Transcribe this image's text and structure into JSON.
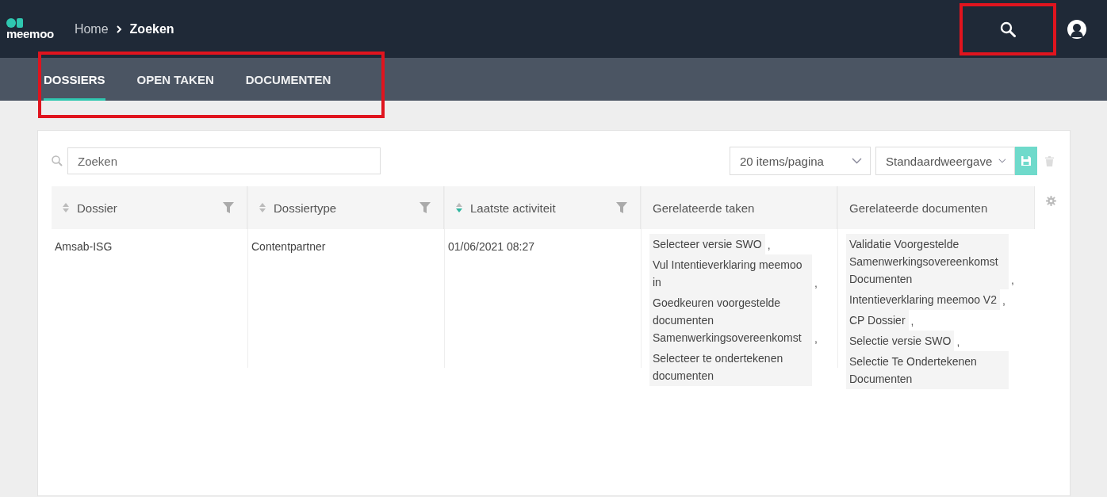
{
  "header": {
    "logo": "meemoo",
    "breadcrumb": [
      {
        "label": "Home",
        "current": false
      },
      {
        "label": "Zoeken",
        "current": true
      }
    ],
    "search_highlighted": true
  },
  "tabs": {
    "highlighted": true,
    "items": [
      {
        "label": "DOSSIERS",
        "selected": true
      },
      {
        "label": "OPEN TAKEN",
        "selected": false
      },
      {
        "label": "DOCUMENTEN",
        "selected": false
      }
    ]
  },
  "toolbar": {
    "search": {
      "placeholder": "Zoeken"
    },
    "page_size": "20 items/pagina",
    "view": "Standaardweergave"
  },
  "table": {
    "columns": [
      {
        "label": "Dossier",
        "sortable": true,
        "sort_descending": false,
        "filterable": true
      },
      {
        "label": "Dossiertype",
        "sortable": true,
        "sort_descending": false,
        "filterable": true
      },
      {
        "label": "Laatste activiteit",
        "sortable": true,
        "sort_descending": true,
        "filterable": true
      },
      {
        "label": "Gerelateerde taken",
        "sortable": false,
        "filterable": false
      },
      {
        "label": "Gerelateerde documenten",
        "sortable": false,
        "filterable": false
      }
    ],
    "rows": [
      {
        "cells": [
          {
            "kind": "text",
            "text": "Amsab-ISG"
          },
          {
            "kind": "text",
            "text": "Contentpartner"
          },
          {
            "kind": "text",
            "text": "01/06/2021 08:27"
          },
          {
            "kind": "links",
            "items": [
              {
                "label": "Selecteer versie SWO",
                "separator": ","
              },
              {
                "label": "Vul Intentieverklaring meemoo in",
                "separator": ","
              },
              {
                "label": "Goedkeuren voorgestelde documenten Samenwerkingsovereenkomst",
                "separator": ","
              },
              {
                "label": "Selecteer te ondertekenen documenten"
              }
            ]
          },
          {
            "kind": "links",
            "items": [
              {
                "label": "Validatie Voorgestelde Samenwerkingsovereenkomst Documenten",
                "separator": ","
              },
              {
                "label": "Intentieverklaring meemoo V2",
                "separator": ","
              },
              {
                "label": "CP Dossier",
                "separator": ","
              },
              {
                "label": "Selectie versie SWO",
                "separator": ","
              },
              {
                "label": "Selectie Te Ondertekenen Documenten"
              }
            ]
          }
        ]
      }
    ]
  }
}
